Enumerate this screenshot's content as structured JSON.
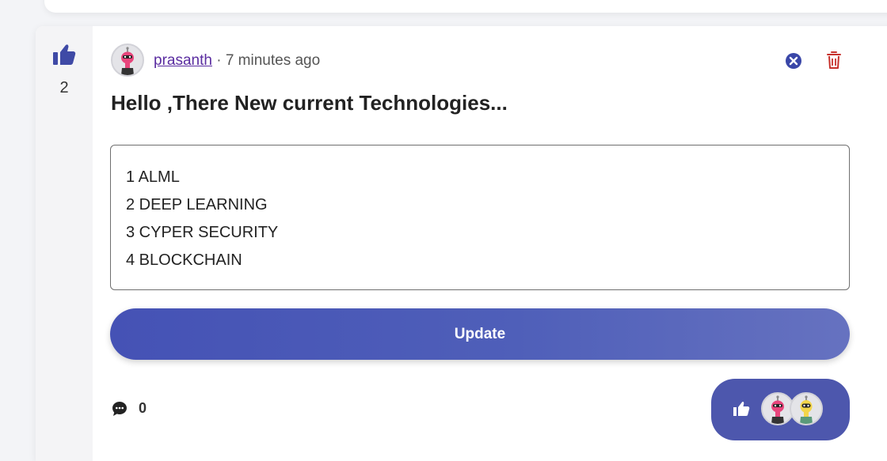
{
  "post": {
    "vote_count": "2",
    "author": "prasanth",
    "time_ago": " · 7 minutes ago",
    "title": "Hello ,There New current Technologies...",
    "body_lines": [
      "1 ALML",
      "2 DEEP LEARNING",
      "3 CYPER SECURITY",
      "4 BLOCKCHAIN"
    ],
    "update_label": "Update",
    "comment_count": "0"
  },
  "colors": {
    "accent": "#4d57ad",
    "author_link": "#5a2ca0",
    "close_icon": "#3a47a8",
    "delete_icon": "#c7312c"
  },
  "icons": [
    "thumbs-up-icon",
    "close-icon",
    "trash-icon",
    "comment-icon"
  ]
}
